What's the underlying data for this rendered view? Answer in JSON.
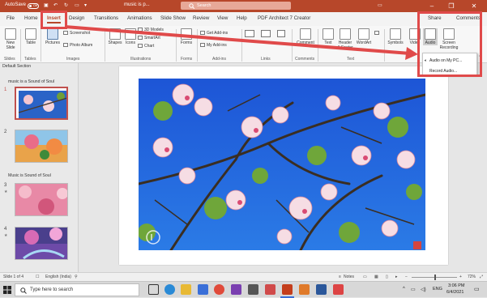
{
  "titlebar": {
    "autosave": "AutoSave",
    "autosave_state": "Off",
    "doc_title": "music is p...",
    "search_placeholder": "Search",
    "minimize": "–",
    "restore": "❐",
    "close": "✕"
  },
  "tabs": [
    "File",
    "Home",
    "Insert",
    "Design",
    "Transitions",
    "Animations",
    "Slide Show",
    "Review",
    "View",
    "Help",
    "PDF Architect 7 Creator"
  ],
  "tab_right": {
    "share": "Share",
    "comments": "Comments"
  },
  "ribbon": {
    "new_slide": "New\nSlide",
    "table": "Table",
    "pictures": "Pictures",
    "screenshot": "Screenshot",
    "photo_album": "Photo Album",
    "shapes": "Shapes",
    "icons": "Icons",
    "models3d": "3D Models",
    "smartart": "SmartArt",
    "chart": "Chart",
    "forms": "Forms",
    "get_addins": "Get Add-ins",
    "my_addins": "My Add-ins",
    "comment": "Comment",
    "text": "Text",
    "header_footer": "Header\n& Footer",
    "wordart": "WordArt",
    "symbols": "Symbols",
    "video": "Video",
    "audio": "Audio",
    "screen_recording": "Screen\nRecording",
    "groups": {
      "slides": "Slides",
      "tables": "Tables",
      "images": "Images",
      "illustrations": "Illustrations",
      "forms": "Forms",
      "addins": "Add-ins",
      "links": "Links",
      "comments": "Comments",
      "text": "Text"
    }
  },
  "audio_menu": {
    "items": [
      "Audio on My PC...",
      "Record Audio..."
    ]
  },
  "slides_panel": {
    "sections": [
      "Default Section",
      "music is a Sound of Soul",
      "Music is Sound of Soul"
    ],
    "slide_numbers": [
      "1",
      "2",
      "3",
      "4"
    ]
  },
  "statusbar": {
    "slide_of": "Slide 1 of 4",
    "language": "English (India)",
    "notes": "Notes",
    "zoom": "72%"
  },
  "taskbar": {
    "search": "Type here to search",
    "language": "ENG",
    "time": "3:06 PM",
    "date": "6/4/2021"
  },
  "colors": {
    "accent": "#b7472a",
    "highlight": "#e04a4a"
  }
}
